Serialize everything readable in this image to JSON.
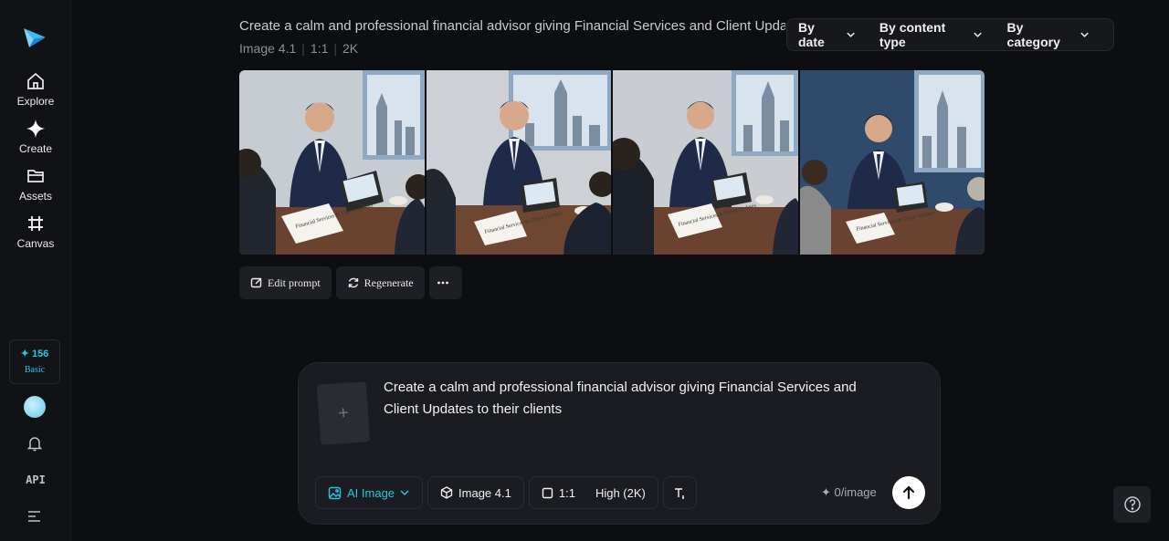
{
  "sidebar": {
    "items": [
      {
        "label": "Explore",
        "icon": "home-icon"
      },
      {
        "label": "Create",
        "icon": "sparkle-icon"
      },
      {
        "label": "Assets",
        "icon": "folder-icon"
      },
      {
        "label": "Canvas",
        "icon": "canvas-grid-icon"
      }
    ],
    "credits": {
      "count": "✦ 156",
      "tier": "Basic"
    },
    "api_label": "API"
  },
  "header": {
    "prompt_title": "Create a calm and professional financial advisor giving Financial Services and Client Updates to their clients",
    "meta": {
      "model": "Image 4.1",
      "ratio": "1:1",
      "resolution": "2K"
    }
  },
  "filters": [
    {
      "label": "By date"
    },
    {
      "label": "By content type"
    },
    {
      "label": "By category"
    }
  ],
  "gallery": {
    "images": [
      {
        "notepad_text": "Financial Services & Client Updates"
      },
      {
        "notepad_text": "Financial Services & Client Updates"
      },
      {
        "notepad_text": "Financial Services & Client Updates"
      },
      {
        "notepad_text": "Financial Services & Client Updates"
      }
    ]
  },
  "actions": {
    "edit_prompt": "Edit prompt",
    "regenerate": "Regenerate",
    "more": "···"
  },
  "composer": {
    "text": "Create a calm and professional financial advisor giving Financial Services and Client Updates to their clients",
    "mode": "AI Image",
    "model": "Image 4.1",
    "ratio": "1:1",
    "quality": "High (2K)",
    "cost": "✦ 0/image"
  },
  "colors": {
    "accent": "#25c6e2",
    "background": "#0d0e11",
    "panel": "#1b1c21"
  }
}
